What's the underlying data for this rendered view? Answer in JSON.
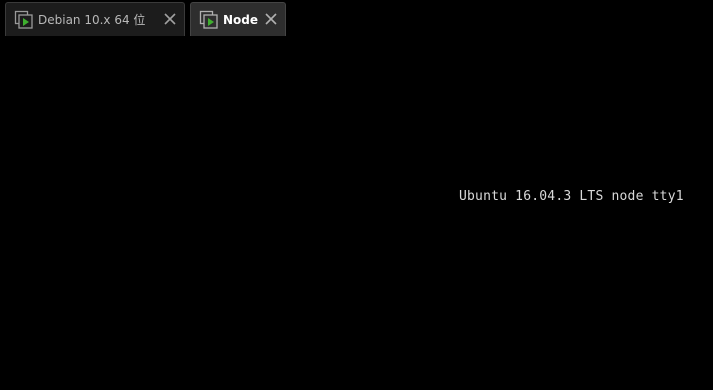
{
  "tabs": [
    {
      "label": "Debian 10.x 64 位",
      "active": false,
      "icon": "vm-play-icon",
      "close_icon": "close-icon"
    },
    {
      "label": "Node",
      "active": true,
      "icon": "vm-play-icon",
      "close_icon": "close-icon"
    }
  ],
  "console": {
    "text": "Ubuntu 16.04.3 LTS node tty1"
  },
  "colors": {
    "background": "#000000",
    "tab_active": "#2e2e2e",
    "tab_inactive": "#1c1c1c",
    "icon_accent": "#3faf2f",
    "console_text": "#d9d9d9"
  }
}
